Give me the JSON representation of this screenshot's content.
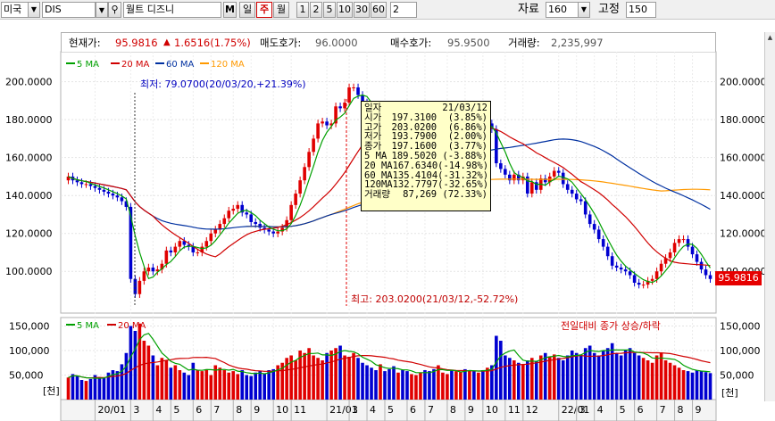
{
  "toolbar": {
    "market": "미국",
    "symbol": "DIS",
    "name": "월트 디즈니",
    "btn_m": "M",
    "periods": [
      "일",
      "주",
      "월"
    ],
    "active_period": "주",
    "minutes": [
      "1",
      "2",
      "5",
      "10",
      "30",
      "60"
    ],
    "custom_minute": "2",
    "data_label": "자료",
    "data_count": "160",
    "fixed_label": "고정",
    "fixed_count": "150"
  },
  "info": {
    "price_label": "현재가:",
    "price": "95.9816",
    "change_arrow": "▲",
    "change": "1.6516(1.75%)",
    "ask_label": "매도호가:",
    "ask": "96.0000",
    "bid_label": "매수호가:",
    "bid": "95.9500",
    "volume_label": "거래량:",
    "volume": "2,235,997"
  },
  "legend": {
    "price": [
      {
        "name": "5 MA",
        "color": "#00a000"
      },
      {
        "name": "20 MA",
        "color": "#d00000"
      },
      {
        "name": "60 MA",
        "color": "#0030a0"
      },
      {
        "name": "120 MA",
        "color": "#ff9900"
      }
    ],
    "volume": [
      {
        "name": "5 MA",
        "color": "#00a000"
      },
      {
        "name": "20 MA",
        "color": "#d00000"
      }
    ]
  },
  "annotations": {
    "low": "최저: 79.0700(20/03/20,+21.39%)",
    "high": "최고: 203.0200(21/03/12,-52.72%)",
    "volume_caption": "전일대비 종가 상승/하락",
    "unit": "[천]"
  },
  "tooltip": [
    {
      "k": "일자",
      "v": "21/03/12"
    },
    {
      "k": "시가",
      "v": "197.3100  (3.85%)"
    },
    {
      "k": "고가",
      "v": "203.0200  (6.86%)"
    },
    {
      "k": "저가",
      "v": "193.7900  (2.00%)"
    },
    {
      "k": "종가",
      "v": "197.1600  (3.77%)"
    },
    {
      "k": "5 MA",
      "v": "189.5020 (-3.88%)"
    },
    {
      "k": "20 MA",
      "v": "167.6340(-14.98%)"
    },
    {
      "k": "60 MA",
      "v": "135.4104(-31.32%)"
    },
    {
      "k": "120MA",
      "v": "132.7797(-32.65%)"
    },
    {
      "k": "거래량",
      "v": "87,269 (72.33%)"
    }
  ],
  "current_badge": "95.9816",
  "chart_data": {
    "type": "line",
    "price_axis": {
      "ticks": [
        "200.0000",
        "180.0000",
        "160.0000",
        "140.0000",
        "120.0000",
        "100.0000"
      ],
      "values": [
        200,
        180,
        160,
        140,
        120,
        100
      ],
      "ylim": [
        78,
        205
      ]
    },
    "volume_axis": {
      "ticks": [
        "150,000",
        "100,000",
        "50,000"
      ],
      "values": [
        150000,
        100000,
        50000
      ],
      "ylim": [
        0,
        160000
      ]
    },
    "x_ticks": [
      "20/01",
      "3",
      "4",
      "5",
      "6",
      "7",
      "8",
      "9",
      "10",
      "11",
      "21/01",
      "3",
      "4",
      "5",
      "6",
      "7",
      "8",
      "9",
      "10",
      "11",
      "12",
      "22/01",
      "3",
      "4",
      "5",
      "6",
      "7",
      "8",
      "9"
    ],
    "x_tick_index": [
      6,
      14,
      19,
      23,
      28,
      32,
      37,
      41,
      46,
      50,
      58,
      63,
      67,
      71,
      76,
      80,
      85,
      89,
      93,
      98,
      102,
      110,
      114,
      118,
      123,
      127,
      132,
      136,
      140
    ],
    "close": [
      150,
      148,
      147,
      146,
      146,
      145,
      144,
      143,
      142,
      141,
      140,
      139,
      137,
      134,
      96,
      88,
      95,
      100,
      102,
      100,
      101,
      104,
      111,
      110,
      113,
      116,
      114,
      113,
      110,
      110,
      113,
      116,
      120,
      122,
      125,
      128,
      132,
      133,
      135,
      131,
      130,
      126,
      125,
      123,
      122,
      121,
      120,
      121,
      123,
      127,
      135,
      141,
      148,
      155,
      163,
      170,
      178,
      179,
      177,
      178,
      187,
      186,
      189,
      197,
      197,
      193,
      189,
      185,
      181,
      178,
      180,
      178,
      176,
      173,
      176,
      174,
      172,
      175,
      178,
      178,
      176,
      173,
      172,
      175,
      176,
      176,
      173,
      174,
      177,
      176,
      178,
      174,
      179,
      176,
      178,
      175,
      157,
      154,
      151,
      148,
      151,
      148,
      150,
      141,
      147,
      143,
      149,
      147,
      150,
      153,
      152,
      146,
      143,
      141,
      138,
      137,
      130,
      125,
      122,
      117,
      113,
      108,
      103,
      102,
      101,
      100,
      98,
      94,
      93,
      93,
      95,
      96,
      100,
      104,
      107,
      110,
      115,
      117,
      117,
      113,
      109,
      105,
      101,
      98,
      96
    ],
    "open": [
      148,
      150,
      148,
      147,
      146,
      146,
      145,
      144,
      143,
      142,
      141,
      140,
      139,
      137,
      134,
      96,
      88,
      95,
      100,
      102,
      100,
      101,
      104,
      111,
      110,
      113,
      116,
      114,
      113,
      110,
      110,
      113,
      116,
      120,
      122,
      125,
      128,
      132,
      133,
      135,
      131,
      130,
      126,
      125,
      123,
      122,
      121,
      120,
      121,
      123,
      127,
      135,
      141,
      148,
      155,
      163,
      170,
      178,
      179,
      177,
      178,
      187,
      186,
      189,
      197,
      197,
      193,
      189,
      185,
      181,
      178,
      180,
      178,
      176,
      173,
      176,
      174,
      172,
      175,
      178,
      178,
      176,
      173,
      172,
      175,
      176,
      176,
      173,
      174,
      177,
      176,
      178,
      174,
      179,
      176,
      178,
      175,
      157,
      154,
      151,
      148,
      151,
      148,
      150,
      141,
      147,
      143,
      149,
      147,
      150,
      153,
      152,
      146,
      143,
      141,
      138,
      137,
      130,
      125,
      122,
      117,
      113,
      108,
      103,
      102,
      101,
      100,
      98,
      94,
      93,
      93,
      95,
      96,
      100,
      104,
      107,
      110,
      115,
      117,
      117,
      113,
      109,
      105,
      101,
      98
    ],
    "volume": [
      45000,
      52000,
      48000,
      40000,
      38000,
      42000,
      50000,
      46000,
      44000,
      55000,
      60000,
      58000,
      72000,
      95000,
      150000,
      140000,
      155000,
      120000,
      110000,
      90000,
      70000,
      85000,
      80000,
      65000,
      70000,
      60000,
      55000,
      50000,
      75000,
      60000,
      58000,
      62000,
      50000,
      70000,
      65000,
      60000,
      55000,
      58000,
      52000,
      60000,
      50000,
      48000,
      55000,
      58000,
      52000,
      60000,
      62000,
      70000,
      75000,
      85000,
      90000,
      80000,
      100000,
      95000,
      105000,
      90000,
      85000,
      80000,
      95000,
      100000,
      105000,
      110000,
      90000,
      87269,
      95000,
      85000,
      75000,
      70000,
      65000,
      60000,
      72000,
      58000,
      62000,
      68000,
      55000,
      60000,
      58000,
      52000,
      50000,
      55000,
      60000,
      58000,
      62000,
      70000,
      55000,
      52000,
      60000,
      58000,
      56000,
      62000,
      60000,
      58000,
      55000,
      60000,
      65000,
      70000,
      130000,
      120000,
      90000,
      85000,
      80000,
      75000,
      72000,
      80000,
      85000,
      78000,
      90000,
      95000,
      88000,
      92000,
      85000,
      80000,
      90000,
      100000,
      95000,
      90000,
      105000,
      110000,
      95000,
      90000,
      100000,
      105000,
      115000,
      95000,
      90000,
      100000,
      105000,
      95000,
      90000,
      85000,
      80000,
      75000,
      90000,
      95000,
      80000,
      75000,
      70000,
      65000,
      60000,
      58000,
      55000,
      60000,
      58000,
      56000,
      54000
    ]
  }
}
